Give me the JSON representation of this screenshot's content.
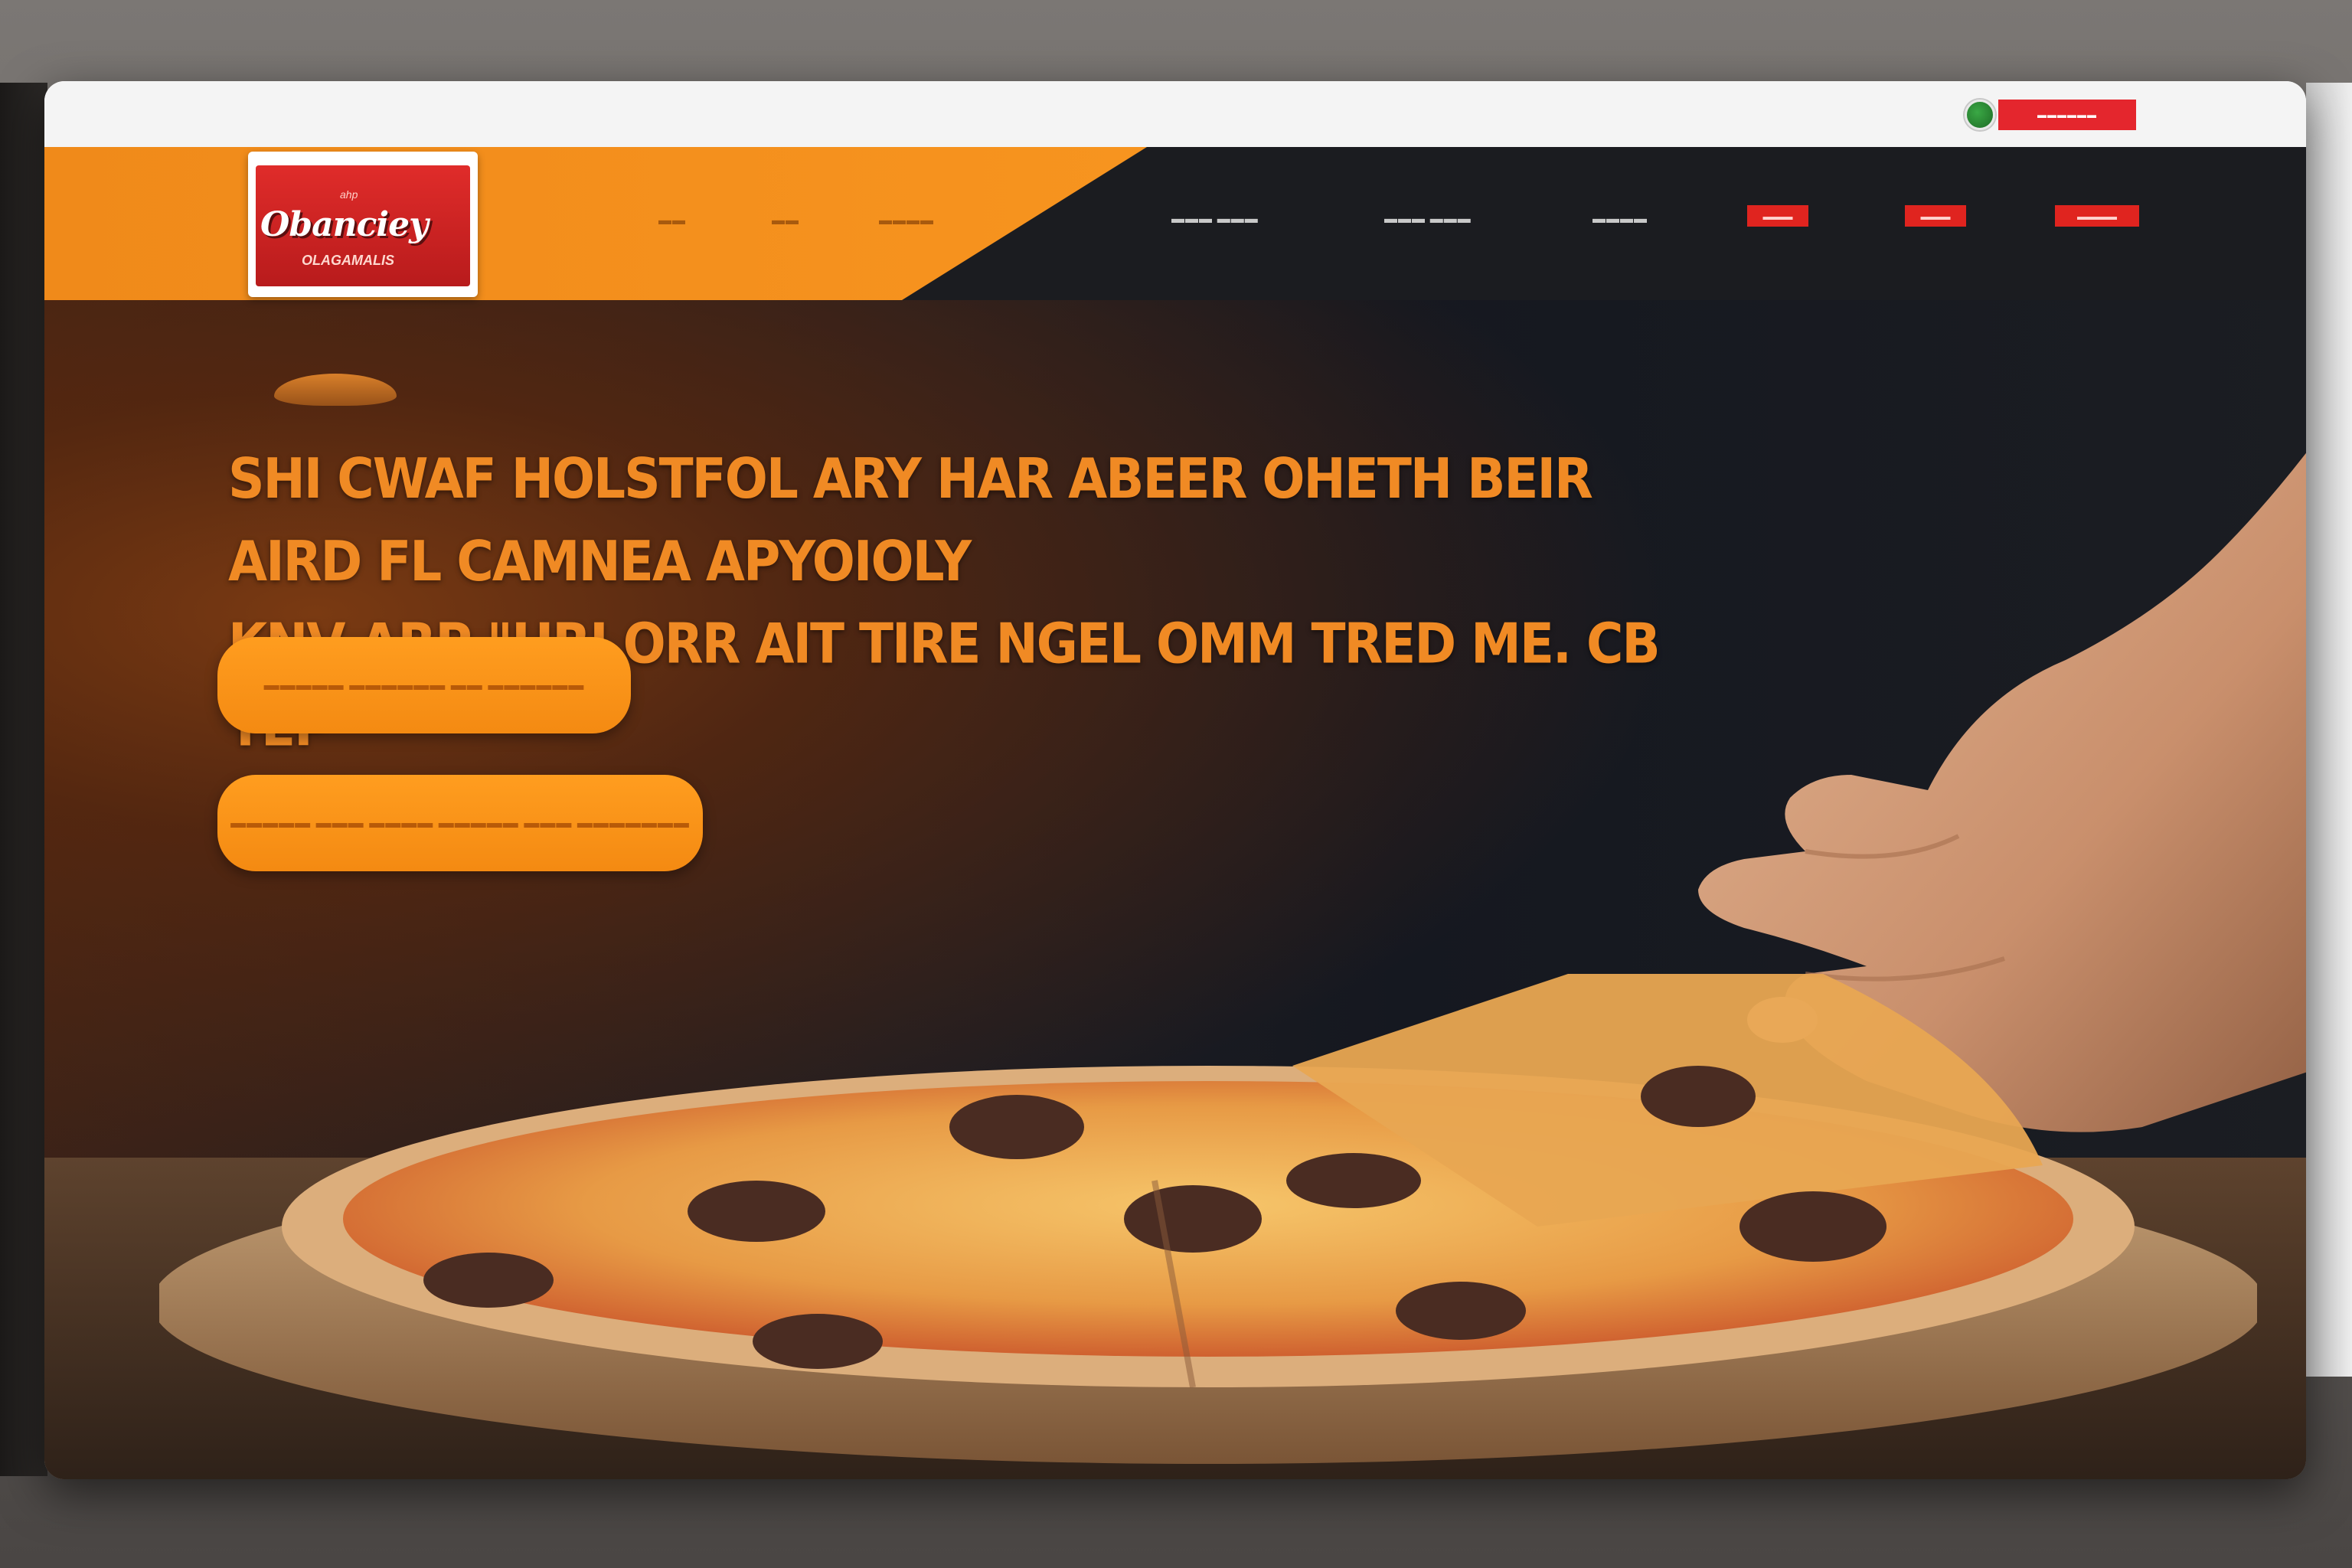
{
  "browser": {
    "lang_button_label": "▬▬▬▬▬▬"
  },
  "brand": {
    "logo_title": "Obanciey",
    "logo_subtitle": "OLAGAMALIS",
    "logo_tag": "ahp"
  },
  "nav": {
    "links_left": [
      "▬▬",
      "▬▬",
      "▬▬▬▬"
    ],
    "links_right": [
      "▬▬▬  ▬▬▬",
      "▬▬▬  ▬▬▬",
      "▬▬▬▬"
    ],
    "red_buttons": [
      "▬▬▬",
      "▬▬▬",
      "▬▬▬▬"
    ]
  },
  "hero": {
    "headline_line1": "SHI CWAF HOLSTFOL ARY HAR ABEER OHETH BEIR AIRD FL CAMNEA APYOIOLY",
    "headline_line2": "KNV ARP \"HRJ ORR AIT TIRE NGEL OMM TRED ME. CB TEP\"",
    "cta_primary_label": "▬▬▬▬▬ ▬▬▬▬▬▬ ▬▬ ▬▬▬▬▬▬",
    "cta_secondary_label": "▬▬▬▬▬ ▬▬▬ ▬▬▬▬ ▬▬▬▬▬ ▬▬▬ ▬▬▬▬▬▬▬"
  },
  "colors": {
    "accent_orange": "#f7941f",
    "nav_dark": "#1b1c20",
    "brand_red": "#e02c2a"
  },
  "images": {
    "hero_photo": "hand lifting pizza slice"
  }
}
